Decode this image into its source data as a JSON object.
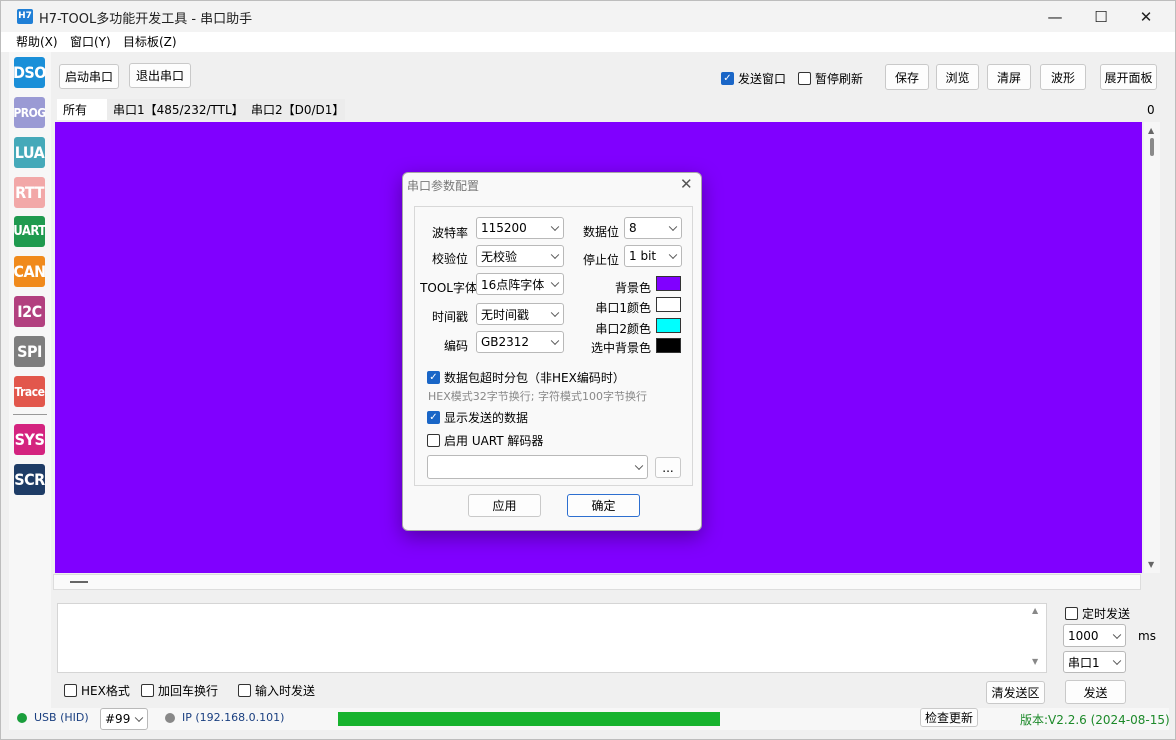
{
  "app": {
    "icon": "H7",
    "title": "H7-TOOL多功能开发工具 - 串口助手"
  },
  "window_controls": {
    "minimize": "—",
    "maximize": "☐",
    "close": "✕"
  },
  "menu": [
    "帮助(X)",
    "窗口(Y)",
    "目标板(Z)"
  ],
  "sidebar": [
    {
      "label": "DSO",
      "color": "#1a8fd8"
    },
    {
      "label": "PROG",
      "color": "#9a9ad4"
    },
    {
      "label": "LUA",
      "color": "#45a9b9"
    },
    {
      "label": "RTT",
      "color": "#f2a8a8"
    },
    {
      "label": "UART",
      "color": "#1f9a4f"
    },
    {
      "label": "CAN",
      "color": "#f08a1c"
    },
    {
      "label": "I2C",
      "color": "#b2407f"
    },
    {
      "label": "SPI",
      "color": "#7e7e7e"
    },
    {
      "label": "Trace",
      "color": "#e2574c"
    },
    {
      "label": "SYS",
      "color": "#d4237f"
    },
    {
      "label": "SCR",
      "color": "#1e3c66"
    }
  ],
  "toolbar": {
    "start_port": "启动串口",
    "exit_port": "退出串口",
    "send_window": {
      "label": "发送窗口",
      "checked": true
    },
    "pause_refresh": {
      "label": "暂停刷新",
      "checked": false
    },
    "save": "保存",
    "browse": "浏览",
    "clear": "清屏",
    "waveform": "波形",
    "expand_panel": "展开面板"
  },
  "tabs": [
    "所有",
    "串口1【485/232/TTL】",
    "串口2【D0/D1】"
  ],
  "tab_counter": "0",
  "dialog": {
    "title": "串口参数配置",
    "baud_label": "波特率",
    "baud_value": "115200",
    "databits_label": "数据位",
    "databits_value": "8",
    "parity_label": "校验位",
    "parity_value": "无校验",
    "stopbits_label": "停止位",
    "stopbits_value": "1 bit",
    "font_label": "TOOL字体",
    "font_value": "16点阵字体",
    "timestamp_label": "时间戳",
    "timestamp_value": "无时间戳",
    "encoding_label": "编码",
    "encoding_value": "GB2312",
    "bg_color_label": "背景色",
    "bg_color": "#8000ff",
    "port1_color_label": "串口1颜色",
    "port1_color": "#ffffff",
    "port2_color_label": "串口2颜色",
    "port2_color": "#00ffff",
    "sel_bg_label": "选中背景色",
    "sel_bg_color": "#000000",
    "packet_split": {
      "label": "数据包超时分包（非HEX编码时）",
      "checked": true
    },
    "hint": "HEX模式32字节换行; 字符模式100字节换行",
    "show_sent": {
      "label": "显示发送的数据",
      "checked": true
    },
    "uart_decoder": {
      "label": "启用 UART 解码器",
      "checked": false
    },
    "decoder_value": "",
    "more_button": "...",
    "apply": "应用",
    "ok": "确定"
  },
  "send_area": {
    "timed_send": {
      "label": "定时发送",
      "checked": false
    },
    "interval": "1000",
    "interval_unit": "ms",
    "port": "串口1",
    "hex_format": {
      "label": "HEX格式",
      "checked": false
    },
    "add_crlf": {
      "label": "加回车换行",
      "checked": false
    },
    "send_on_input": {
      "label": "输入时发送",
      "checked": false
    },
    "clear_send": "清发送区",
    "send": "发送"
  },
  "statusbar": {
    "usb": "USB (HID)",
    "usb_color": "#1a9e3c",
    "device": "#99",
    "ip": "IP (192.168.0.101)",
    "progress": 1.0,
    "check_update": "检查更新",
    "version": "版本:V2.2.6 (2024-08-15)"
  }
}
